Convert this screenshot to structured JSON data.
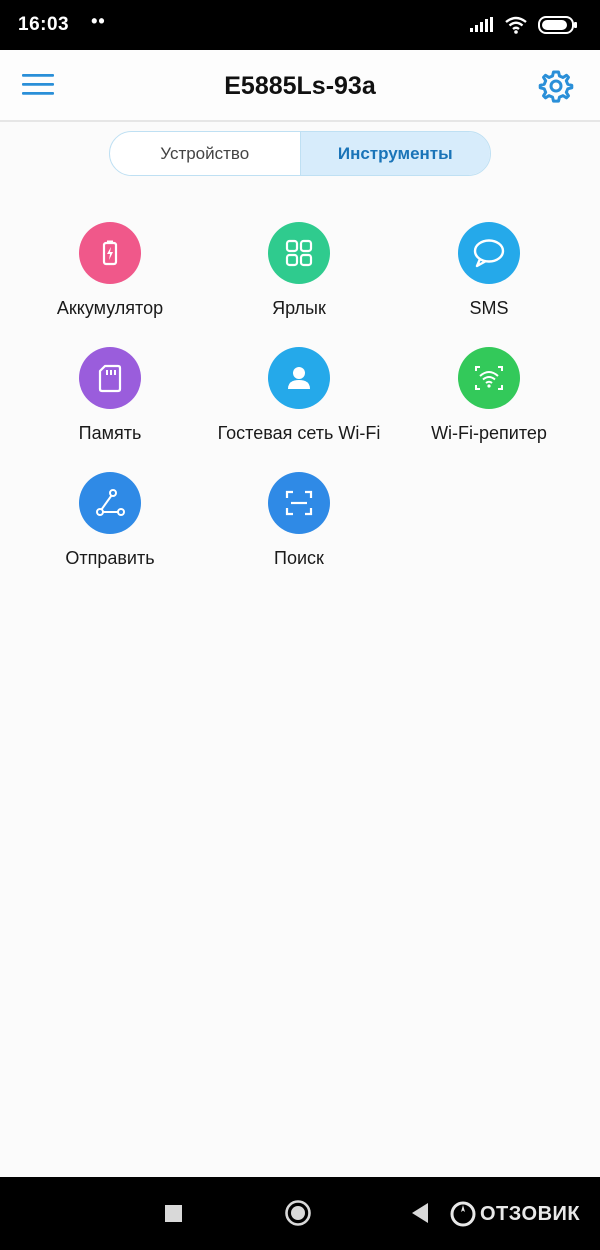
{
  "status_bar": {
    "time": "16:03",
    "dots": "••"
  },
  "header": {
    "title": "E5885Ls-93a",
    "menu_icon": "hamburger-menu-icon",
    "settings_icon": "gear-icon",
    "accent_color": "#2a8fd8"
  },
  "tabs": [
    {
      "label": "Устройство",
      "active": false
    },
    {
      "label": "Инструменты",
      "active": true
    }
  ],
  "tools": [
    {
      "label": "Аккумулятор",
      "icon": "battery-icon",
      "color": "#f0588a"
    },
    {
      "label": "Ярлык",
      "icon": "grid-shortcut-icon",
      "color": "#2fcb8e"
    },
    {
      "label": "SMS",
      "icon": "message-bubble-icon",
      "color": "#25a9ea"
    },
    {
      "label": "Память",
      "icon": "sd-card-icon",
      "color": "#9a5ddc"
    },
    {
      "label": "Гостевая сеть Wi-Fi",
      "icon": "guest-user-icon",
      "color": "#25a9ea"
    },
    {
      "label": "Wi-Fi-репитер",
      "icon": "wifi-repeater-icon",
      "color": "#33c95a"
    },
    {
      "label": "Отправить",
      "icon": "share-send-icon",
      "color": "#2f8ae6"
    },
    {
      "label": "Поиск",
      "icon": "scan-search-icon",
      "color": "#2f8ae6"
    }
  ],
  "watermark": {
    "text": "ОТЗОВИК"
  }
}
